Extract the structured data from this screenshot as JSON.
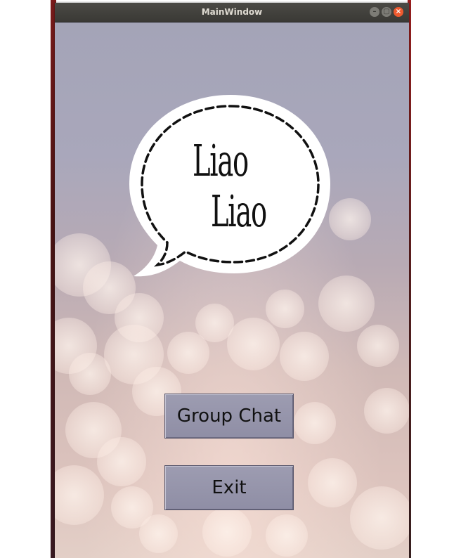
{
  "window": {
    "title": "MainWindow",
    "controls": {
      "minimize": "–",
      "maximize": "▢",
      "close": "×"
    }
  },
  "logo": {
    "line1": "Liao",
    "line2": "Liao"
  },
  "buttons": {
    "group_chat_label": "Group Chat",
    "exit_label": "Exit"
  },
  "colors": {
    "titlebar": "#3f3e3a",
    "close_button": "#ef5a2f",
    "button_fill": "#9594aa"
  }
}
